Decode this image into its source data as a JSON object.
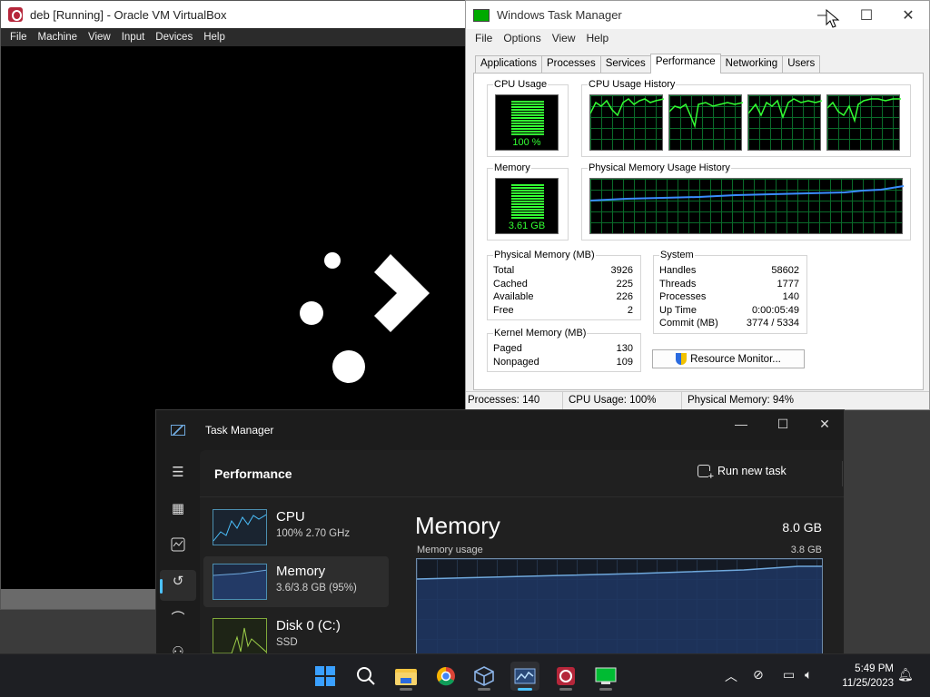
{
  "vbox": {
    "title": "deb [Running] - Oracle VM VirtualBox",
    "menu": [
      "File",
      "Machine",
      "View",
      "Input",
      "Devices",
      "Help"
    ]
  },
  "classic_tm": {
    "title": "Windows Task Manager",
    "menu": [
      "File",
      "Options",
      "View",
      "Help"
    ],
    "tabs": [
      "Applications",
      "Processes",
      "Services",
      "Performance",
      "Networking",
      "Users"
    ],
    "active_tab": "Performance",
    "cpu_usage_label": "CPU Usage",
    "cpu_usage_value": "100 %",
    "cpu_history_label": "CPU Usage History",
    "memory_label": "Memory",
    "memory_value": "3.61 GB",
    "mem_history_label": "Physical Memory Usage History",
    "physical_memory": {
      "label": "Physical Memory (MB)",
      "rows": [
        {
          "k": "Total",
          "v": "3926"
        },
        {
          "k": "Cached",
          "v": "225"
        },
        {
          "k": "Available",
          "v": "226"
        },
        {
          "k": "Free",
          "v": "2"
        }
      ]
    },
    "kernel_memory": {
      "label": "Kernel Memory (MB)",
      "rows": [
        {
          "k": "Paged",
          "v": "130"
        },
        {
          "k": "Nonpaged",
          "v": "109"
        }
      ]
    },
    "system": {
      "label": "System",
      "rows": [
        {
          "k": "Handles",
          "v": "58602"
        },
        {
          "k": "Threads",
          "v": "1777"
        },
        {
          "k": "Processes",
          "v": "140"
        },
        {
          "k": "Up Time",
          "v": "0:00:05:49"
        },
        {
          "k": "Commit (MB)",
          "v": "3774 / 5334"
        }
      ]
    },
    "resource_monitor_button": "Resource Monitor...",
    "status": {
      "processes": "Processes: 140",
      "cpu": "CPU Usage: 100%",
      "memory": "Physical Memory: 94%"
    }
  },
  "tm11": {
    "title": "Task Manager",
    "page_title": "Performance",
    "run_new_task": "Run new task",
    "more": "•••",
    "resources": [
      {
        "name": "CPU",
        "sub": "100%  2.70 GHz"
      },
      {
        "name": "Memory",
        "sub": "3.6/3.8 GB (95%)"
      },
      {
        "name": "Disk 0 (C:)",
        "sub": "SSD"
      }
    ],
    "memory_heading": "Memory",
    "memory_total": "8.0 GB",
    "memory_usage_label": "Memory usage",
    "memory_usage_max": "3.8 GB"
  },
  "taskbar": {
    "time": "5:49 PM",
    "date": "11/25/2023",
    "icons": [
      "start-icon",
      "search-icon",
      "file-explorer-icon",
      "chrome-icon",
      "virtualbox-icon",
      "task-manager-icon",
      "vm-deb-icon",
      "classic-task-manager-icon"
    ]
  },
  "colors": {
    "accent": "#4cc2ff",
    "meter_green": "#33ff33",
    "graph_blue": "#2a6be0"
  }
}
